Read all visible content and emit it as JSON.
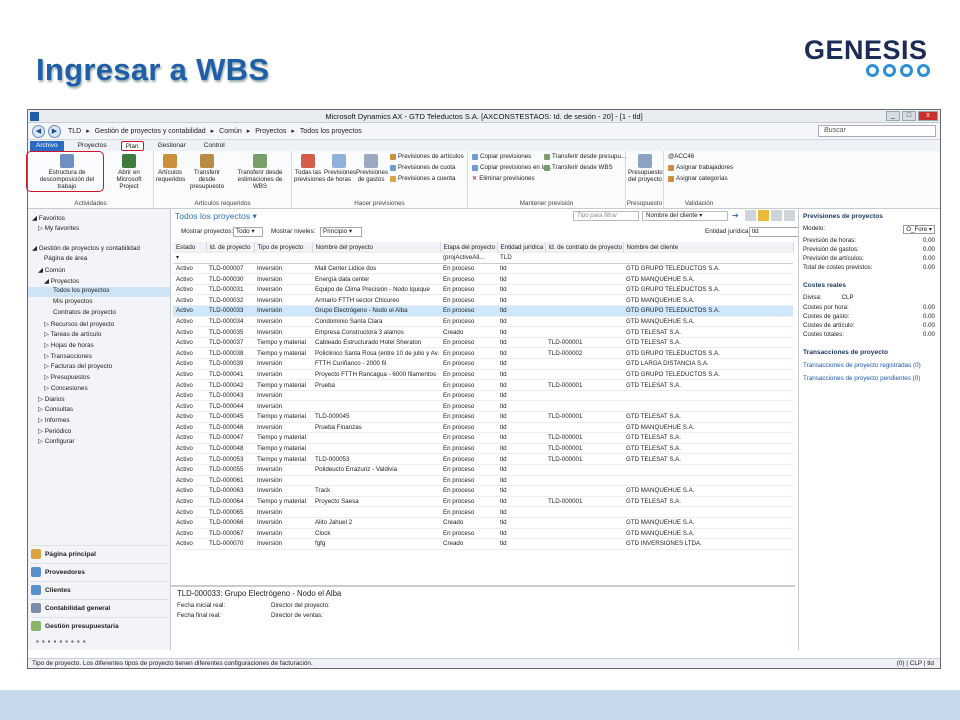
{
  "slide": {
    "title": "Ingresar a WBS",
    "logo_text": "GENESIS"
  },
  "window": {
    "title": "Microsoft Dynamics AX - GTD Teleductos S.A. [AXCONSTESTAOS: Id. de sesión - 20] - [1 - tld]",
    "controls": [
      "_",
      "□",
      "x"
    ]
  },
  "address": {
    "breadcrumb": [
      "TLD",
      "Gestión de proyectos y contabilidad",
      "Común",
      "Proyectos",
      "Todos los proyectos"
    ],
    "search_placeholder": "Buscar"
  },
  "menu_tabs": [
    "Archivo",
    "Proyectos",
    "Plan",
    "Gestionar",
    "Control"
  ],
  "ribbon": {
    "group_actividades": "Actividades",
    "btn_wbs": "Estructura de descomposición del trabajo",
    "btn_project": "Abrir en Microsoft Project",
    "group_articulos": "Artículos requeridos",
    "btn_art_req": "Artículos requeridos",
    "btn_transfer_presupuesto": "Transferir desde presupuesto",
    "btn_transfer_wbs": "Transferir desde estimaciones de WBS",
    "group_hacer": "Hacer previsiones",
    "btn_todas": "Todas las previsiones",
    "btn_prev_horas": "Previsiones de horas",
    "btn_prev_gastos": "Previsiones de gastos",
    "small_prev_articulos": "Previsiones de artículos",
    "small_prev_cuota": "Previsiones de cuota",
    "small_prev_cuenta": "Previsiones a cuenta",
    "group_mantener": "Mantener previsión",
    "small_copiar": "Copiar previsiones",
    "small_copiar_la": "Copiar previsiones en la...",
    "small_eliminar": "Eliminar previsiones",
    "small_transf_presup": "Transferir desde presupu...",
    "small_transf_wbs": "Transferir desde WBS",
    "group_presupuesto": "Presupuesto",
    "btn_presupuesto": "Presupuesto del proyecto",
    "group_validacion": "Validación",
    "val_code": "@ACC46",
    "small_asignar_trab": "Asignar trabajadores",
    "small_asignar_cat": "Asignar categorías"
  },
  "nav": {
    "favoritos": "Favoritos",
    "my_favorites": "My favorites",
    "module": "Gestión de proyectos y contabilidad",
    "pagina_area": "Página de área",
    "comun": "Común",
    "proyectos": "Proyectos",
    "todos": "Todos los proyectos",
    "mis": "Mis proyectos",
    "contratos": "Contratos de proyecto",
    "recursos": "Recursos del proyecto",
    "tareas": "Tareas de artículo",
    "hojas": "Hojas de horas",
    "transacciones": "Transacciones",
    "facturas": "Facturas del proyecto",
    "presupuestos": "Presupuestos",
    "concesiones": "Concesiones",
    "diarios": "Diarios",
    "consultas": "Consultas",
    "informes": "Informes",
    "periodico": "Periódico",
    "configurar": "Configurar",
    "modules": [
      "Página principal",
      "Proveedores",
      "Clientes",
      "Contabilidad general",
      "Gestión presupuestaria"
    ]
  },
  "list": {
    "title": "Todos los proyectos",
    "filter_placeholder": "Tipo para filtrar",
    "filter_field": "Nombre del cliente",
    "mostrar_label": "Mostrar proyectos:",
    "mostrar_value": "Todo",
    "niveles_label": "Mostrar niveles:",
    "niveles_value": "Principio",
    "entidad_label": "Entidad jurídica:",
    "entidad_value": "tld",
    "columns": [
      "Estado",
      "Id. de proyecto",
      "Tipo de proyecto",
      "Nombre del proyecto",
      "Etapa del proyecto",
      "Entidad jurídica",
      "Id. de contrato de proyecto",
      "Nombre del cliente"
    ],
    "filter_etapa": "(projActiveAll...",
    "filter_entidad": "TLD",
    "rows": [
      [
        "Activo",
        "TLD-000007",
        "Inversión",
        "Mall Center Lidice dos",
        "En proceso",
        "tld",
        "",
        "GTD GRUPO TELEDUCTOS S.A."
      ],
      [
        "Activo",
        "TLD-000030",
        "Inversión",
        "Energía data center",
        "En proceso",
        "tld",
        "",
        "GTD MANQUEHUE S.A."
      ],
      [
        "Activo",
        "TLD-000031",
        "Inversión",
        "Equipo de Clima Precisión - Nodo Iquique",
        "En proceso",
        "tld",
        "",
        "GTD GRUPO TELEDUCTOS S.A."
      ],
      [
        "Activo",
        "TLD-000032",
        "Inversión",
        "Armario FTTH sector Chicureo",
        "En proceso",
        "tld",
        "",
        "GTD MANQUEHUE S.A."
      ],
      [
        "Activo",
        "TLD-000033",
        "Inversión",
        "Grupo Electrógeno - Nodo el Alba",
        "En proceso",
        "tld",
        "",
        "GTD GRUPO TELEDUCTOS S.A."
      ],
      [
        "Activo",
        "TLD-000034",
        "Inversión",
        "Condominio Santa Clara",
        "En proceso",
        "tld",
        "",
        "GTD MANQUEHUE S.A."
      ],
      [
        "Activo",
        "TLD-000035",
        "Inversión",
        "Empresa Constructora 3 alamos",
        "Creado",
        "tld",
        "",
        "GTD TELESAT S.A."
      ],
      [
        "Activo",
        "TLD-000037",
        "Tiempo y material",
        "Cableado Estructurado Hotel Sheraton",
        "En proceso",
        "tld",
        "TLD-000001",
        "GTD TELESAT S.A."
      ],
      [
        "Activo",
        "TLD-000038",
        "Tiempo y material",
        "Policlinico Santa Rosa (entre 10 de julio y Av. M...",
        "En proceso",
        "tld",
        "TLD-000002",
        "GTD GRUPO TELEDUCTOS S.A."
      ],
      [
        "Activo",
        "TLD-000039",
        "Inversión",
        "FTTH Curiñanco - 2000 fil",
        "En proceso",
        "tld",
        "",
        "GTD LARGA DISTANCIA S.A."
      ],
      [
        "Activo",
        "TLD-000041",
        "Inversión",
        "Proyecto FTTH Rancagua - 6000 filamentos",
        "En proceso",
        "tld",
        "",
        "GTD GRUPO TELEDUCTOS S.A."
      ],
      [
        "Activo",
        "TLD-000042",
        "Tiempo y material",
        "Prueba",
        "En proceso",
        "tld",
        "TLD-000001",
        "GTD TELESAT S.A."
      ],
      [
        "Activo",
        "TLD-000043",
        "Inversión",
        "",
        "En proceso",
        "tld",
        "",
        ""
      ],
      [
        "Activo",
        "TLD-000044",
        "Inversión",
        "",
        "En proceso",
        "tld",
        "",
        ""
      ],
      [
        "Activo",
        "TLD-000045",
        "Tiempo y material",
        "TLD-000045",
        "En proceso",
        "tld",
        "TLD-000001",
        "GTD TELESAT S.A."
      ],
      [
        "Activo",
        "TLD-000046",
        "Inversión",
        "Prueba Finanzas",
        "En proceso",
        "tld",
        "",
        "GTD MANQUEHUE S.A."
      ],
      [
        "Activo",
        "TLD-000047",
        "Tiempo y material",
        "",
        "En proceso",
        "tld",
        "TLD-000001",
        "GTD TELESAT S.A."
      ],
      [
        "Activo",
        "TLD-000048",
        "Tiempo y material",
        "",
        "En proceso",
        "tld",
        "TLD-000001",
        "GTD TELESAT S.A."
      ],
      [
        "Activo",
        "TLD-000053",
        "Tiempo y material",
        "TLD-000053",
        "En proceso",
        "tld",
        "TLD-000001",
        "GTD TELESAT S.A."
      ],
      [
        "Activo",
        "TLD-000055",
        "Inversión",
        "Polideucto Errazuriz - Valdivia",
        "En proceso",
        "tld",
        "",
        ""
      ],
      [
        "Activo",
        "TLD-000061",
        "Inversión",
        "",
        "En proceso",
        "tld",
        "",
        ""
      ],
      [
        "Activo",
        "TLD-000063",
        "Inversión",
        "Track",
        "En proceso",
        "tld",
        "",
        "GTD MANQUEHUE S.A."
      ],
      [
        "Activo",
        "TLD-000064",
        "Tiempo y material",
        "Proyecto Saesa",
        "En proceso",
        "tld",
        "TLD-000001",
        "GTD TELESAT S.A."
      ],
      [
        "Activo",
        "TLD-000065",
        "Inversión",
        "",
        "En proceso",
        "tld",
        "",
        ""
      ],
      [
        "Activo",
        "TLD-000066",
        "Inversión",
        "Alito Jahuel 2",
        "Creado",
        "tld",
        "",
        "GTD MANQUEHUE S.A."
      ],
      [
        "Activo",
        "TLD-000067",
        "Inversión",
        "Clock",
        "En proceso",
        "tld",
        "",
        "GTD MANQUEHUE S.A."
      ],
      [
        "Activo",
        "TLD-000070",
        "Inversión",
        "fgfg",
        "Creado",
        "tld",
        "",
        "GTD INVERSIONES LTDA."
      ]
    ],
    "selected_index": 4
  },
  "detail": {
    "title": "TLD-000033: Grupo Electrógeno - Nodo el Alba",
    "fecha_inicial": "Fecha inicial real:",
    "fecha_final": "Fecha final real:",
    "director_proyecto": "Director del proyecto:",
    "director_ventas": "Director de ventas:"
  },
  "right": {
    "prev_title": "Previsiones de proyectos",
    "modelo_label": "Modelo:",
    "modelo_value": "O_Fore",
    "prev_rows": [
      [
        "Previsión de horas:",
        "0.00"
      ],
      [
        "Previsión de gastos:",
        "0.00"
      ],
      [
        "Previsión de artículos:",
        "0.00"
      ],
      [
        "Total de costes previstos:",
        "0.00"
      ]
    ],
    "costes_title": "Costes reales",
    "divisa_label": "Divisa:",
    "divisa_value": "CLP",
    "costes_rows": [
      [
        "Costes por hora:",
        "0.00"
      ],
      [
        "Costes de gasto:",
        "0.00"
      ],
      [
        "Costes de artículo:",
        "0.00"
      ],
      [
        "Costes totales:",
        "0.00"
      ]
    ],
    "trans_title": "Transacciones de proyecto",
    "trans_links": [
      "Transacciones de proyecto registradas (0)",
      "Transacciones de proyecto pendientes (0)"
    ]
  },
  "status": {
    "text": "Tipo de proyecto. Los diferentes tipos de proyecto tienen diferentes configuraciones de facturación.",
    "right": "(0)  |  CLP  |  tld"
  },
  "colors": {
    "accent": "#1f5fa8",
    "highlight": "#d0142a",
    "selected_row": "#cfe6fb"
  }
}
